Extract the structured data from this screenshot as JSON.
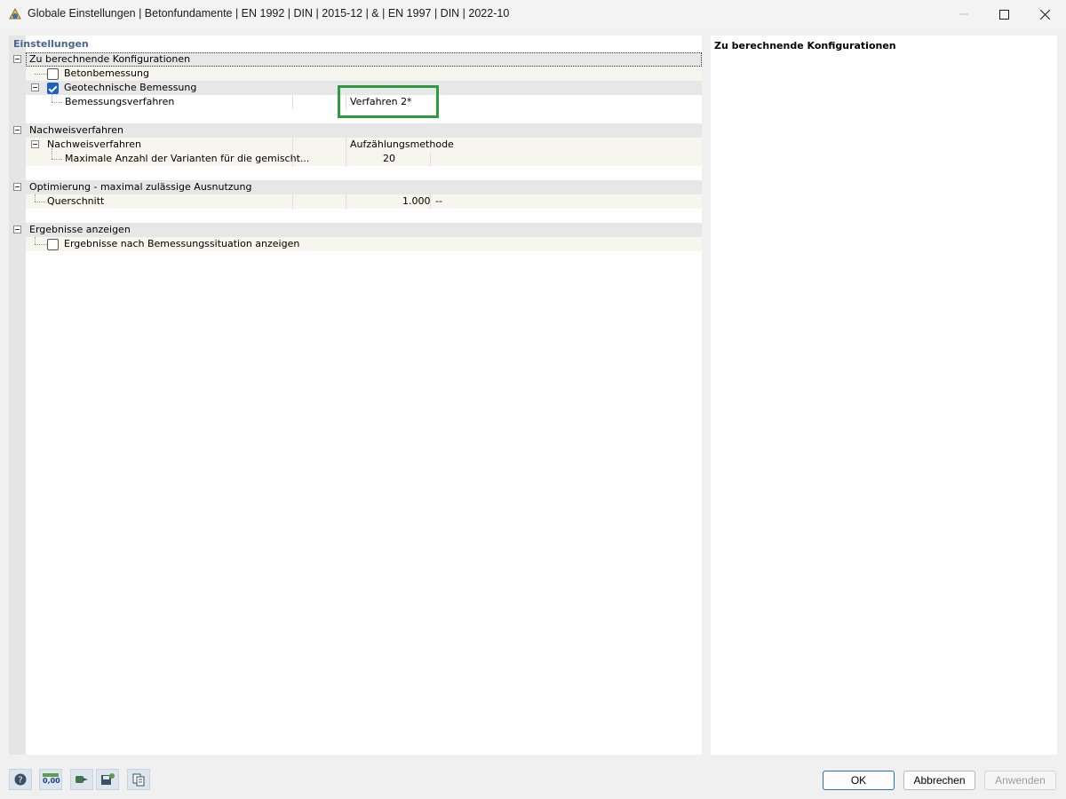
{
  "window": {
    "title": "Globale Einstellungen | Betonfundamente | EN 1992 | DIN | 2015-12 | & | EN 1997 | DIN | 2022-10",
    "icons": [
      "app-icon",
      "minimize-icon",
      "maximize-icon",
      "close-icon"
    ]
  },
  "left": {
    "header": "Einstellungen",
    "groups": {
      "g1": {
        "label": "Zu berechnende Konfigurationen",
        "betonbemessung": {
          "label": "Betonbemessung",
          "checked": false
        },
        "geotechnisch": {
          "label": "Geotechnische Bemessung",
          "checked": true
        },
        "bemessungsverfahren": {
          "label": "Bemessungsverfahren",
          "value": "Verfahren 2*"
        }
      },
      "g2": {
        "label": "Nachweisverfahren",
        "nachweisverfahren": {
          "label": "Nachweisverfahren",
          "value": "Aufzählungsmethode"
        },
        "maxvarianten": {
          "label": "Maximale Anzahl der Varianten für die gemischt...",
          "value": "20"
        }
      },
      "g3": {
        "label": "Optimierung - maximal zulässige Ausnutzung",
        "querschnitt": {
          "label": "Querschnitt",
          "value": "1.000",
          "unit": "--"
        }
      },
      "g4": {
        "label": "Ergebnisse anzeigen",
        "nachsituation": {
          "label": "Ergebnisse nach Bemessungssituation anzeigen",
          "checked": false
        }
      }
    }
  },
  "right": {
    "title": "Zu berechnende Konfigurationen"
  },
  "toolbar": {
    "icons": [
      "help-icon",
      "decimal-places-icon",
      "import-icon",
      "save-settings-icon",
      "copy-settings-icon"
    ],
    "decimal_label": "0,00"
  },
  "buttons": {
    "ok": "OK",
    "cancel": "Abbrechen",
    "apply": "Anwenden"
  },
  "colors": {
    "header_text": "#49648f",
    "highlight": "#2e9b3e",
    "checkbox_checked": "#1d60c8"
  }
}
